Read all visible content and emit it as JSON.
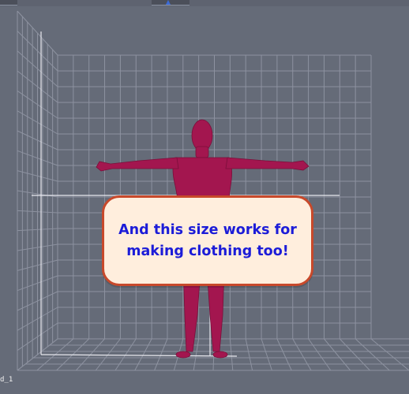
{
  "viewport": {
    "name": "3D viewport",
    "corner_label": "d_1",
    "gizmo_icon": "axis-gizmo-icon",
    "colors": {
      "background": "#656b78",
      "grid": "#8d92a0",
      "figure": "#a3164f",
      "callout_border": "#c8492b",
      "callout_fill": "#ffeedd",
      "callout_text": "#1c1cd8"
    }
  },
  "callout": {
    "text": "And this size works for\nmaking clothing too!"
  }
}
